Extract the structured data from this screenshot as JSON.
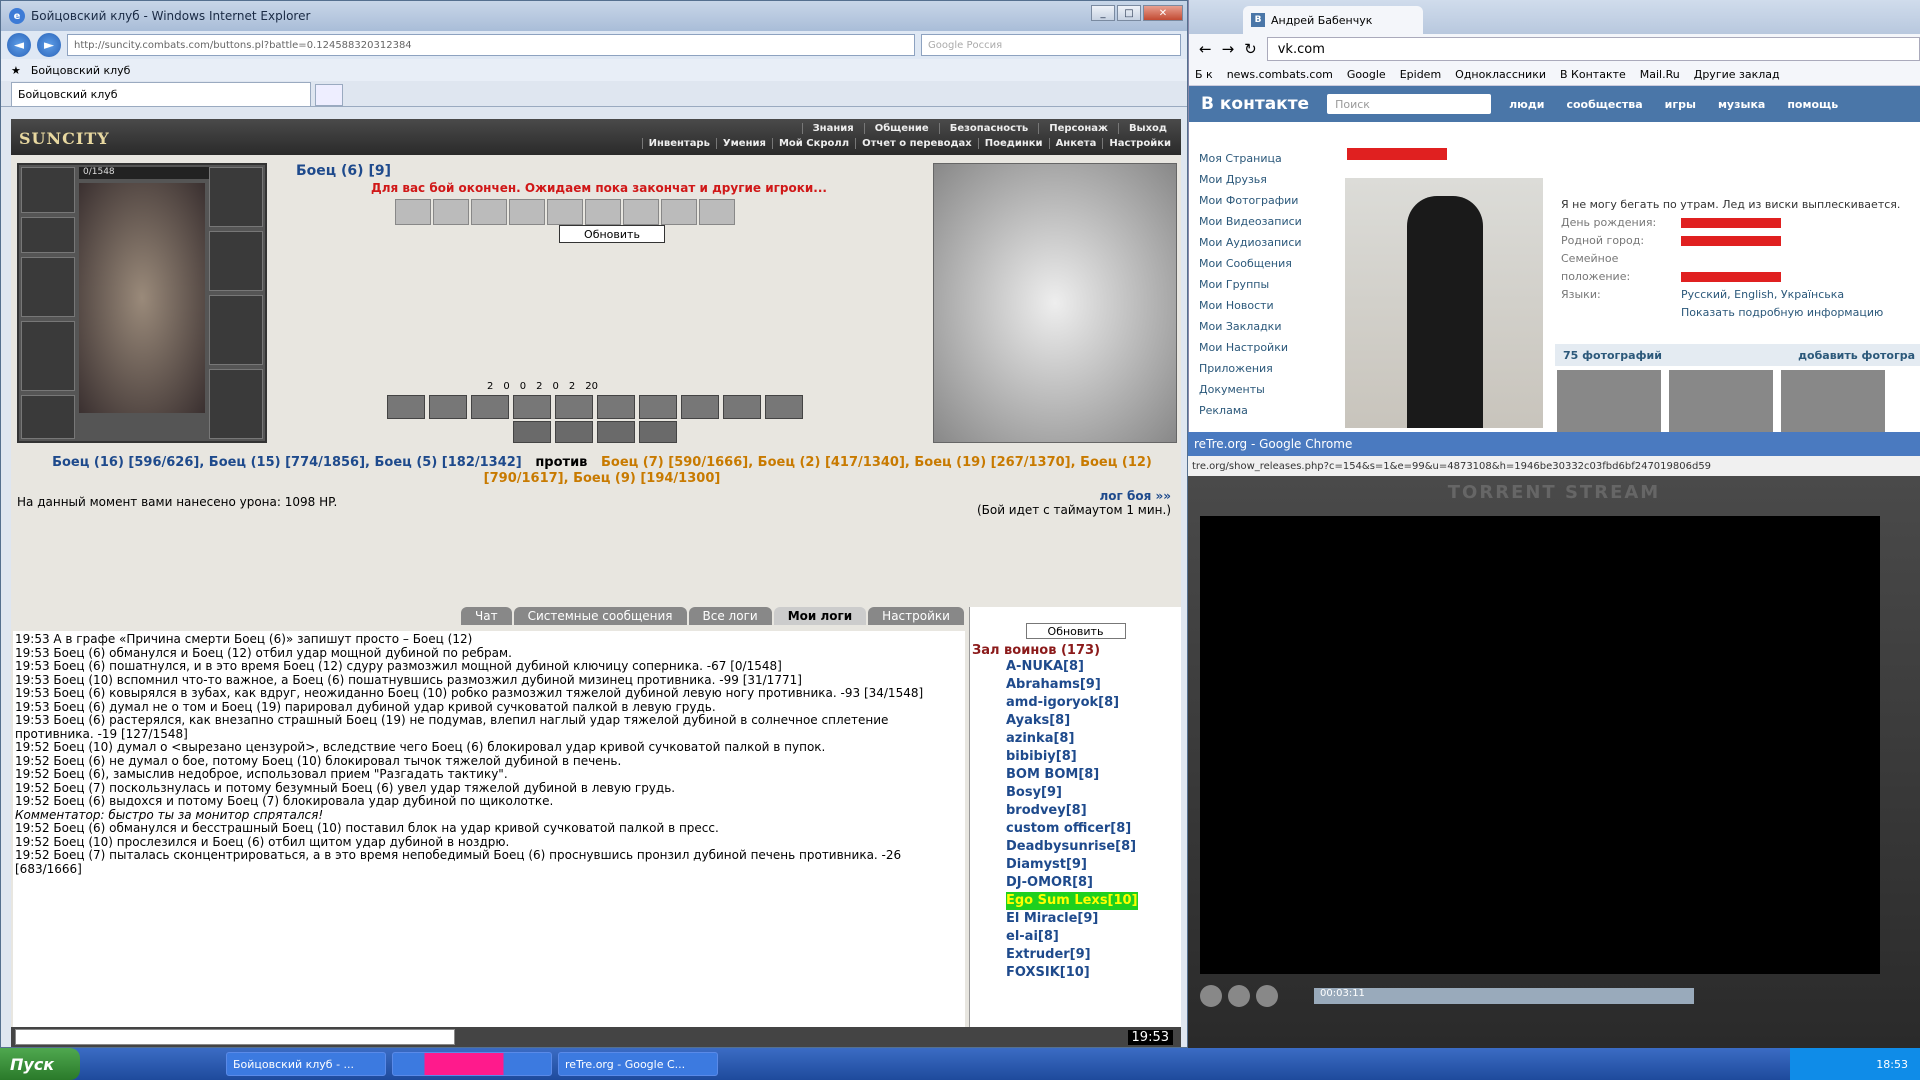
{
  "ie": {
    "title": "Бойцовский клуб - Windows Internet Explorer",
    "url": "http://suncity.combats.com/buttons.pl?battle=0.124588320312384",
    "search_placeholder": "Google Россия",
    "fav": "Бойцовский клуб",
    "tab": "Бойцовский клуб"
  },
  "game": {
    "logo": "SUNCITY",
    "menu": [
      "Знания",
      "Общение",
      "Безопасность",
      "Персонаж",
      "Выход"
    ],
    "menu2": [
      "Инвентарь",
      "Умения",
      "Мой Скролл",
      "Отчет о переводах",
      "Поединки",
      "Анкета",
      "Настройки"
    ],
    "hp": "0/1548",
    "enemy": "Боец (6) [9]",
    "message": "Для вас бой окончен. Ожидаем пока закончат и другие игроки...",
    "refresh": "Обновить",
    "stats": [
      "2",
      "0",
      "0",
      "2",
      "0",
      "2",
      "20"
    ],
    "team1": "Боец (16) [596/626], Боец (15) [774/1856], Боец (5) [182/1342]",
    "vs": "против",
    "team2": "Боец (7) [590/1666], Боец (2) [417/1340], Боец (19) [267/1370], Боец (12) [790/1617], Боец (9) [194/1300]",
    "damage": "На данный момент вами нанесено урона: 1098 HP.",
    "log_link": "лог боя »»",
    "timeout": "(Бой идет с таймаутом 1 мин.)",
    "chat_tabs": [
      "Чат",
      "Системные сообщения",
      "Все логи",
      "Мои логи",
      "Настройки"
    ],
    "log": [
      "19:53 А в графе «Причина смерти Боец (6)» запишут просто – Боец (12)",
      "19:53 Боец (6) обманулся и Боец (12) отбил удар мощной дубиной по ребрам.",
      "19:53 Боец (6) пошатнулся, и в это время Боец (12) сдуру размозжил мощной дубиной ключицу соперника. -67 [0/1548]",
      "19:53 Боец (10) вспомнил что-то важное, а Боец (6) пошатнувшись размозжил дубиной мизинец противника. -99 [31/1771]",
      "19:53 Боец (6) ковырялся в зубах, как вдруг, неожиданно Боец (10) робко размозжил тяжелой дубиной левую ногу противника. -93 [34/1548]",
      "19:53 Боец (6) думал не о том и Боец (19) парировал дубиной удар кривой сучковатой палкой в левую грудь.",
      "19:53 Боец (6) растерялся, как внезапно страшный Боец (19) не подумав, влепил наглый удар тяжелой дубиной в солнечное сплетение противника. -19 [127/1548]",
      "19:52 Боец (10) думал о <вырезано цензурой>, вследствие чего Боец (6) блокировал удар кривой сучковатой палкой в пупок.",
      "19:52 Боец (6) не думал о бое, потому Боец (10) блокировал тычок тяжелой дубиной в печень.",
      "19:52 Боец (6), замыслив недоброе, использовал прием \"Разгадать тактику\".",
      "19:52 Боец (7) поскользнулась и потому безумный Боец (6) увел удар тяжелой дубиной в левую грудь.",
      "19:52 Боец (6) выдохся и потому Боец (7) блокировала удар дубиной по щиколотке.",
      "Комментатор: быстро ты за монитор спрятался!",
      "19:52 Боец (6) обманулся и бесстрашный Боец (10) поставил блок на удар кривой сучковатой палкой в пресс.",
      "19:52 Боец (10) прослезился и Боец (6) отбил щитом удар дубиной в ноздрю.",
      "19:52 Боец (7) пыталась сконцентрироваться, а в это время непобедимый Боец (6) проснувшись пронзил дубиной печень противника. -26 [683/1666]"
    ],
    "online_refresh": "Обновить",
    "hall": "Зал воинов (173)",
    "players": [
      "A-NUKA[8]",
      "Abrahams[9]",
      "amd-igoryok[8]",
      "Ayaks[8]",
      "azinka[8]",
      "bibibiy[8]",
      "BOM BOM[8]",
      "Bosy[9]",
      "brodvey[8]",
      "custom officer[8]",
      "Deadbysunrise[8]",
      "Diamyst[9]",
      "DJ-OMOR[8]",
      "Ego Sum Lexs[10]",
      "El Miracle[9]",
      "el-ai[8]",
      "Extruder[9]",
      "FOXSIK[10]"
    ],
    "clock": "19:53"
  },
  "chrome1": {
    "tab": "Андрей Бабенчук",
    "url": "vk.com",
    "bookmarks": [
      "Б к",
      "news.combats.com",
      "Google",
      "Epidem",
      "Одноклассники",
      "В Контакте",
      "Mail.Ru",
      "Другие заклад"
    ],
    "vk_logo": "В контакте",
    "vk_search": "Поиск",
    "vk_menu": [
      "люди",
      "сообщества",
      "игры",
      "музыка",
      "помощь"
    ],
    "side": [
      "Моя Страница",
      "Мои Друзья",
      "Мои Фотографии",
      "Мои Видеозаписи",
      "Мои Аудиозаписи",
      "Мои Сообщения",
      "Мои Группы",
      "Мои Новости",
      "Мои Закладки",
      "Мои Настройки",
      "Приложения",
      "Документы",
      "Реклама"
    ],
    "status": "Я не могу бегать по утрам. Лед из виски выплескивается.",
    "info": [
      {
        "l": "День рождения:",
        "v": ""
      },
      {
        "l": "Родной город:",
        "v": ""
      },
      {
        "l": "Семейное положение:",
        "v": ""
      },
      {
        "l": "Языки:",
        "v": "Русский, English, Українська"
      }
    ],
    "more": "Показать подробную информацию",
    "photos": "75 фотографий",
    "add_photo": "добавить фотогра"
  },
  "chrome2": {
    "title": "reTre.org - Google Chrome",
    "url": "tre.org/show_releases.php?c=154&s=1&e=99&u=4873108&h=1946be30332c03fbd6bf247019806d59",
    "player": "TORRENT STREAM",
    "time": "00:03:11"
  },
  "taskbar": {
    "start": "Пуск",
    "items": [
      "Бойцовский клуб - ...",
      "",
      "reTre.org - Google C..."
    ],
    "time": "18:53"
  }
}
